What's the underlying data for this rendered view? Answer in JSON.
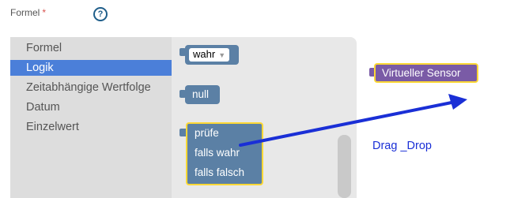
{
  "form": {
    "label": "Formel",
    "required_marker": "*",
    "help_icon": "?"
  },
  "toolbox": {
    "categories": [
      {
        "label": "Formel",
        "selected": false
      },
      {
        "label": "Logik",
        "selected": true
      },
      {
        "label": "Zeitabhängige Wertfolge",
        "selected": false
      },
      {
        "label": "Datum",
        "selected": false
      },
      {
        "label": "Einzelwert",
        "selected": false
      }
    ]
  },
  "flyout": {
    "bool_block": {
      "value": "wahr"
    },
    "null_block": {
      "label": "null"
    },
    "check_block": {
      "line1": "prüfe",
      "line2": "falls wahr",
      "line3": "falls falsch"
    }
  },
  "canvas": {
    "sensor_block": {
      "label": "Virtueller Sensor"
    },
    "annotation": "Drag _Drop"
  },
  "colors": {
    "logic_block": "#5b80a5",
    "sensor_block": "#7a5ba6",
    "highlight": "#fdd835",
    "selected_category": "#4b7fd9",
    "arrow": "#1a2fd6"
  }
}
